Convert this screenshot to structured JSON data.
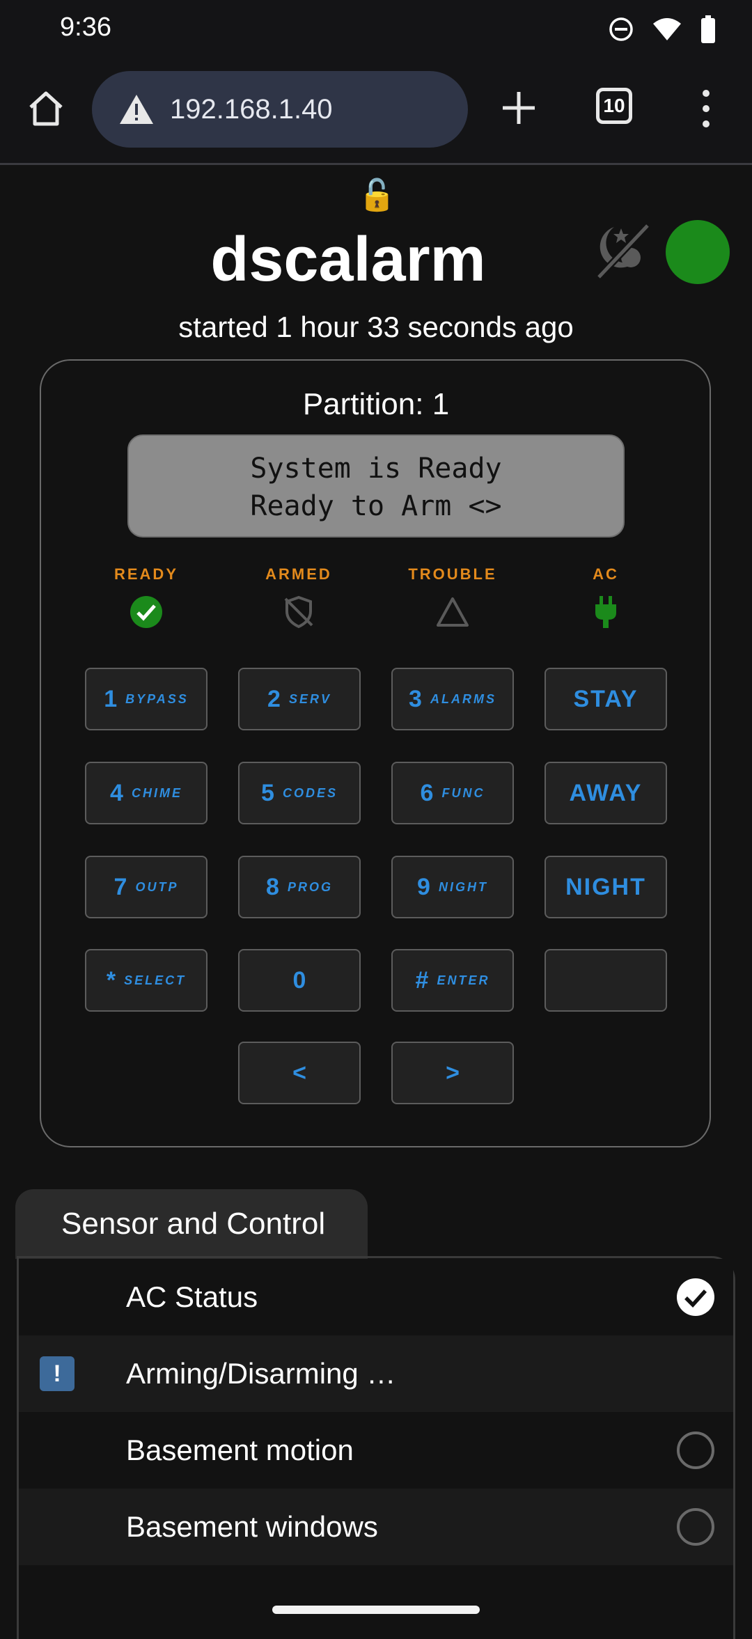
{
  "status_bar": {
    "time": "9:36"
  },
  "browser": {
    "url": "192.168.1.40",
    "tab_count": "10"
  },
  "page": {
    "lock_icon": "🔓",
    "title": "dscalarm",
    "subtitle": "started 1 hour 33 seconds ago",
    "status_color": "#1b8a1b"
  },
  "partition": {
    "label": "Partition: 1",
    "lcd_line1": "System is Ready",
    "lcd_line2": "Ready to Arm <>"
  },
  "indicators": {
    "ready": "READY",
    "armed": "ARMED",
    "trouble": "TROUBLE",
    "ac": "AC"
  },
  "keypad": {
    "k1": {
      "num": "1",
      "sub": "BYPASS"
    },
    "k2": {
      "num": "2",
      "sub": "SERV"
    },
    "k3": {
      "num": "3",
      "sub": "ALARMS"
    },
    "stay": "STAY",
    "k4": {
      "num": "4",
      "sub": "CHIME"
    },
    "k5": {
      "num": "5",
      "sub": "CODES"
    },
    "k6": {
      "num": "6",
      "sub": "FUNC"
    },
    "away": "AWAY",
    "k7": {
      "num": "7",
      "sub": "OUTP"
    },
    "k8": {
      "num": "8",
      "sub": "PROG"
    },
    "k9": {
      "num": "9",
      "sub": "NIGHT"
    },
    "night": "NIGHT",
    "kstar": {
      "num": "*",
      "sub": "SELECT"
    },
    "k0": {
      "num": "0"
    },
    "khash": {
      "num": "#",
      "sub": "ENTER"
    },
    "left": "<",
    "right": ">"
  },
  "sensors": {
    "header": "Sensor and Control",
    "items": [
      {
        "name": "AC Status",
        "state": "checked"
      },
      {
        "name": "Arming/Disarming …",
        "state": "warning"
      },
      {
        "name": "Basement motion",
        "state": "unchecked"
      },
      {
        "name": "Basement windows",
        "state": "unchecked"
      }
    ]
  }
}
